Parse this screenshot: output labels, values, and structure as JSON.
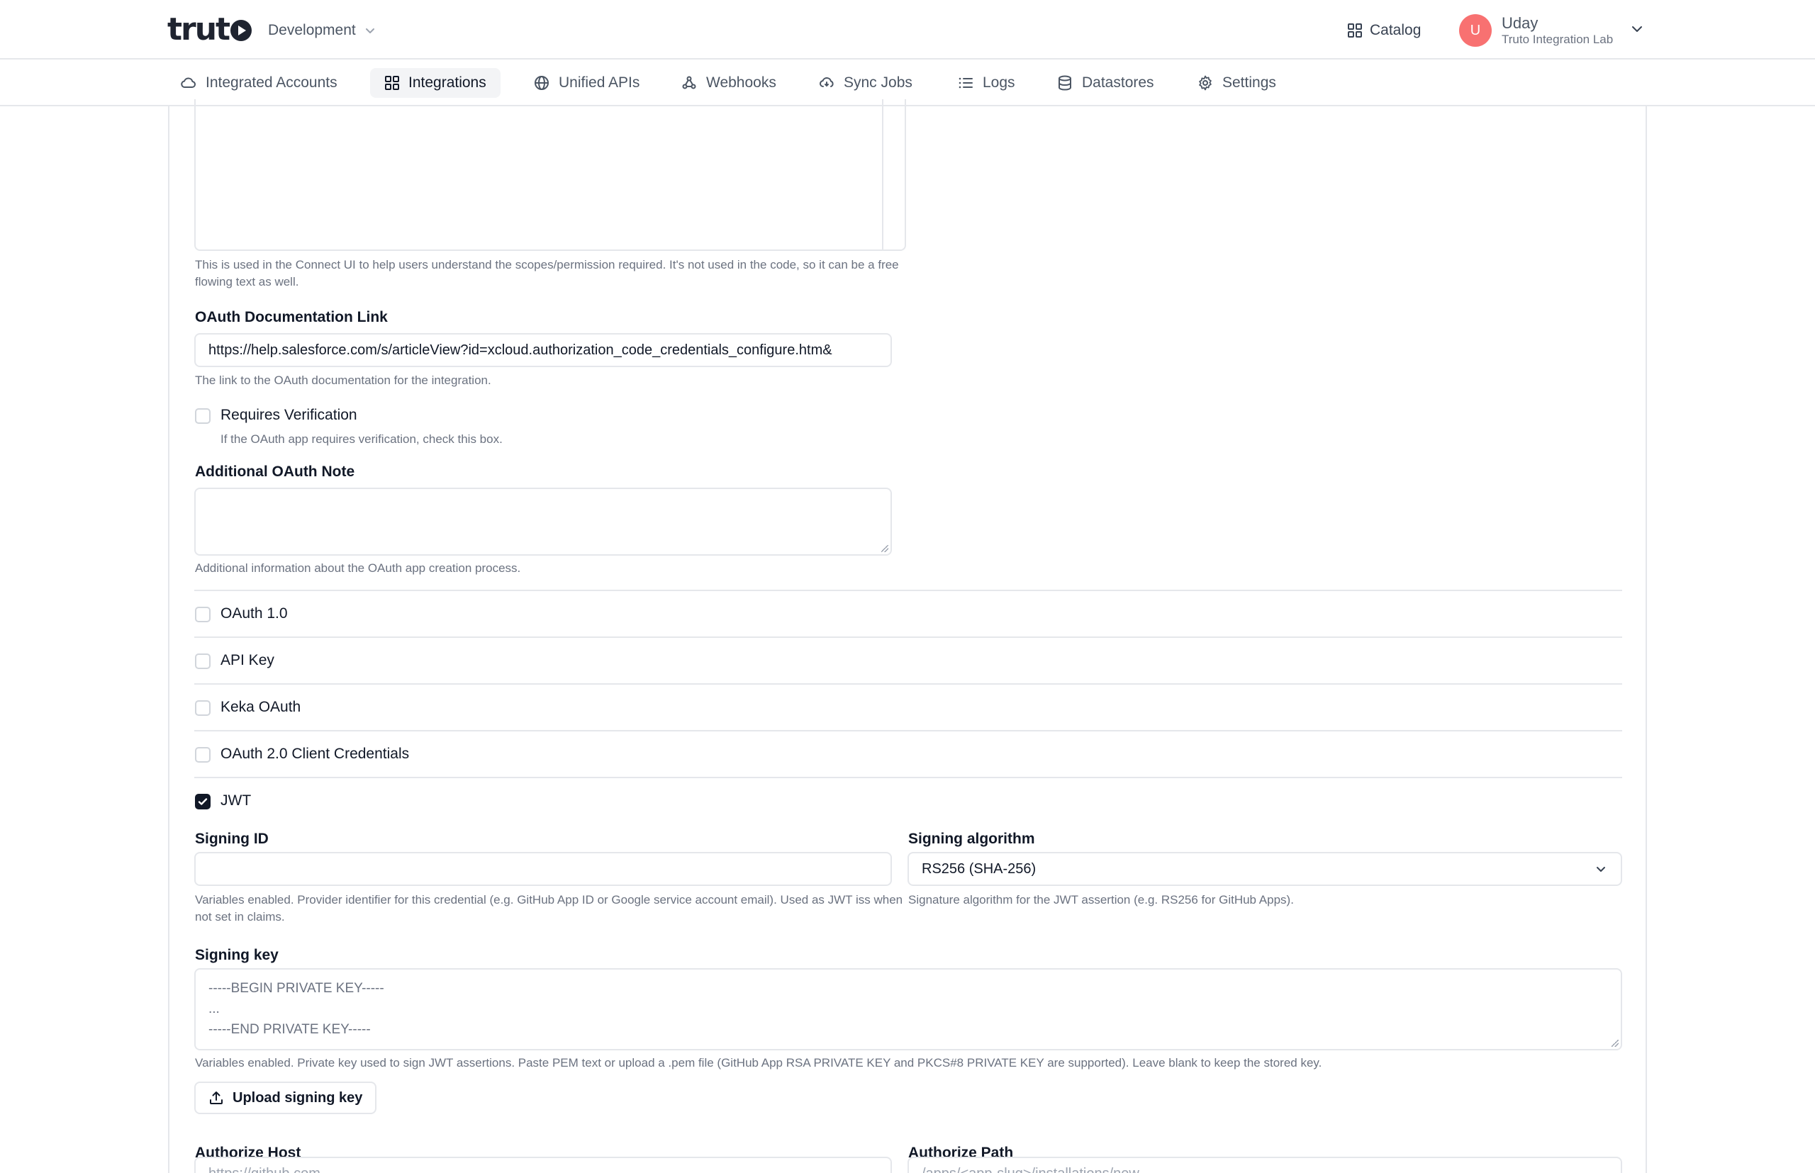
{
  "header": {
    "logo_text": "truto",
    "environment": "Development",
    "catalog_label": "Catalog",
    "user": {
      "initial": "U",
      "name": "Uday",
      "org": "Truto Integration Lab"
    }
  },
  "nav": {
    "items": [
      {
        "label": "Integrated Accounts",
        "icon": "cloud-icon"
      },
      {
        "label": "Integrations",
        "icon": "grid-icon",
        "active": true
      },
      {
        "label": "Unified APIs",
        "icon": "globe-icon"
      },
      {
        "label": "Webhooks",
        "icon": "webhook-icon"
      },
      {
        "label": "Sync Jobs",
        "icon": "sync-cloud-icon"
      },
      {
        "label": "Logs",
        "icon": "list-icon"
      },
      {
        "label": "Datastores",
        "icon": "database-icon"
      },
      {
        "label": "Settings",
        "icon": "gear-icon"
      }
    ]
  },
  "form": {
    "scopes_help": "This is used in the Connect UI to help users understand the scopes/permission required. It's not used in the code, so it can be a free flowing text as well.",
    "oauth_doc_label": "OAuth Documentation Link",
    "oauth_doc_value": "https://help.salesforce.com/s/articleView?id=xcloud.authorization_code_credentials_configure.htm&",
    "oauth_doc_help": "The link to the OAuth documentation for the integration.",
    "requires_verification_label": "Requires Verification",
    "requires_verification_help": "If the OAuth app requires verification, check this box.",
    "additional_note_label": "Additional OAuth Note",
    "additional_note_help": "Additional information about the OAuth app creation process.",
    "auth_methods": [
      {
        "label": "OAuth 1.0",
        "checked": false
      },
      {
        "label": "API Key",
        "checked": false
      },
      {
        "label": "Keka OAuth",
        "checked": false
      },
      {
        "label": "OAuth 2.0 Client Credentials",
        "checked": false
      },
      {
        "label": "JWT",
        "checked": true
      }
    ],
    "jwt": {
      "signing_id_label": "Signing ID",
      "signing_id_help": "Variables enabled. Provider identifier for this credential (e.g. GitHub App ID or Google service account email). Used as JWT iss when not set in claims.",
      "signing_algorithm_label": "Signing algorithm",
      "signing_algorithm_value": "RS256 (SHA-256)",
      "signing_algorithm_help": "Signature algorithm for the JWT assertion (e.g. RS256 for GitHub Apps).",
      "signing_key_label": "Signing key",
      "signing_key_placeholder_lines": [
        "-----BEGIN PRIVATE KEY-----",
        "...",
        "-----END PRIVATE KEY-----"
      ],
      "signing_key_help": "Variables enabled. Private key used to sign JWT assertions. Paste PEM text or upload a .pem file (GitHub App RSA PRIVATE KEY and PKCS#8 PRIVATE KEY are supported). Leave blank to keep the stored key.",
      "upload_label": "Upload signing key",
      "authorize_host_label": "Authorize Host",
      "authorize_host_placeholder": "https://github.com",
      "authorize_path_label": "Authorize Path",
      "authorize_path_placeholder": "/apps/<app-slug>/installations/new"
    }
  },
  "colors": {
    "accent": "#111827",
    "avatar": "#f87171",
    "border": "#e5e7eb",
    "muted": "#6b7280"
  }
}
